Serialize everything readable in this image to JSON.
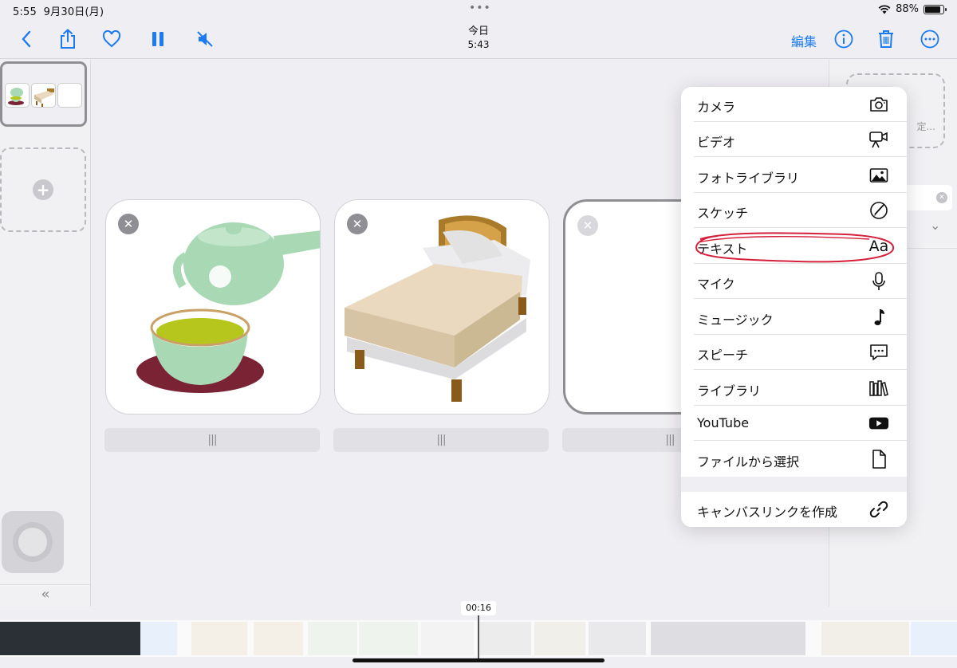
{
  "status_bar": {
    "time": "5:55",
    "date": "9月30日(月)",
    "battery_percent": "88%",
    "battery_level": 0.88
  },
  "toolbar": {
    "title": "今日",
    "subtitle": "5:43",
    "edit_label": "編集"
  },
  "inspector": {
    "hidden_text": "定..."
  },
  "menu": {
    "items": [
      {
        "label": "カメラ",
        "icon": "camera-icon"
      },
      {
        "label": "ビデオ",
        "icon": "video-camera-icon"
      },
      {
        "label": "フォトライブラリ",
        "icon": "photo-icon"
      },
      {
        "label": "スケッチ",
        "icon": "sketch-icon"
      },
      {
        "label": "テキスト",
        "icon": "text-aa-icon",
        "icon_text": "Aa"
      },
      {
        "label": "マイク",
        "icon": "microphone-icon"
      },
      {
        "label": "ミュージック",
        "icon": "music-note-icon"
      },
      {
        "label": "スピーチ",
        "icon": "speech-bubble-icon"
      },
      {
        "label": "ライブラリ",
        "icon": "library-icon"
      },
      {
        "label": "YouTube",
        "icon": "youtube-icon"
      },
      {
        "label": "ファイルから選択",
        "icon": "file-icon"
      },
      {
        "label": "キャンバスリンクを作成",
        "icon": "link-icon"
      }
    ]
  },
  "timeline": {
    "current_time": "00:16"
  },
  "colors": {
    "accent": "#1d7bf2",
    "annotation": "#d4203a"
  }
}
